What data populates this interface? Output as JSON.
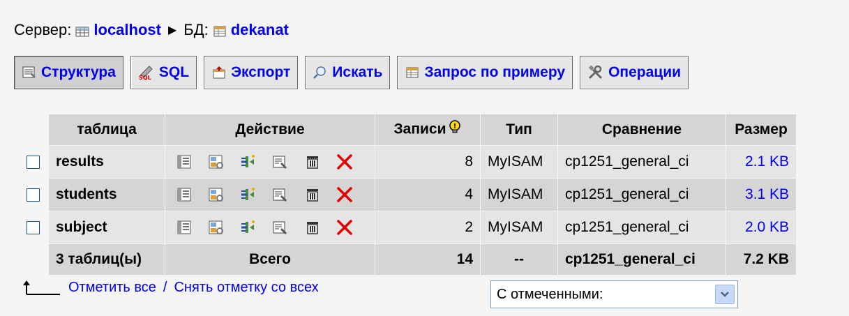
{
  "breadcrumb": {
    "server_label": "Сервер:",
    "server_name": "localhost",
    "arrow": "▶",
    "db_label": "БД:",
    "db_name": "dekanat"
  },
  "tabs": [
    {
      "label": "Структура",
      "icon": "structure-icon",
      "active": true
    },
    {
      "label": "SQL",
      "icon": "sql-icon"
    },
    {
      "label": "Экспорт",
      "icon": "export-icon"
    },
    {
      "label": "Искать",
      "icon": "search-icon"
    },
    {
      "label": "Запрос по примеру",
      "icon": "query-icon"
    },
    {
      "label": "Операции",
      "icon": "operations-icon"
    }
  ],
  "table": {
    "headers": {
      "table": "таблица",
      "action": "Действие",
      "records": "Записи",
      "type": "Тип",
      "collation": "Сравнение",
      "size": "Размер"
    },
    "rows": [
      {
        "name": "results",
        "records": "8",
        "type": "MyISAM",
        "collation": "cp1251_general_ci",
        "size": "2.1 KB"
      },
      {
        "name": "students",
        "records": "4",
        "type": "MyISAM",
        "collation": "cp1251_general_ci",
        "size": "3.1 KB"
      },
      {
        "name": "subject",
        "records": "2",
        "type": "MyISAM",
        "collation": "cp1251_general_ci",
        "size": "2.0 KB"
      }
    ],
    "total": {
      "count_label": "3 таблиц(ы)",
      "sum_label": "Всего",
      "records": "14",
      "type": "--",
      "collation": "cp1251_general_ci",
      "size": "7.2 KB"
    },
    "action_icons": [
      "browse-icon",
      "structure-icon",
      "insert-icon",
      "properties-icon",
      "empty-icon",
      "drop-icon"
    ]
  },
  "bottom": {
    "check_all": "Отметить все",
    "separator": "/",
    "uncheck_all": "Снять отметку со всех",
    "with_selected": "С отмеченными:"
  },
  "colors": {
    "link": "#0000ee",
    "header_bg": "#d5d5d5",
    "row_light": "#e5e5e5",
    "drop_red": "#e00000"
  }
}
